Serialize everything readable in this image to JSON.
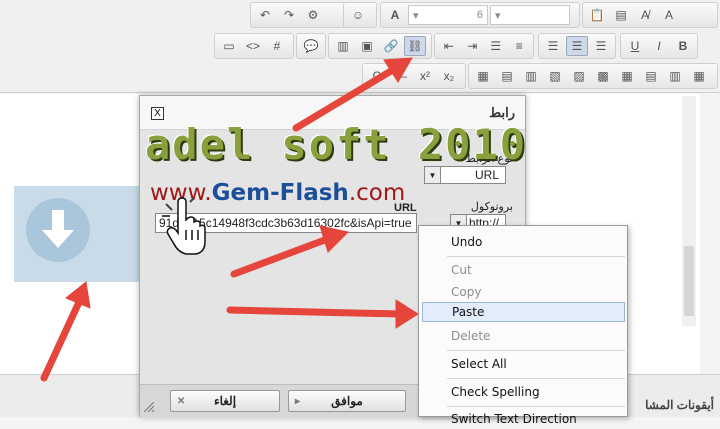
{
  "toolbar": {
    "font_size_value": "6"
  },
  "dialog": {
    "title": "رابط",
    "close_label": "X",
    "link_type_label": "نوع الرابط",
    "link_type_value": "URL",
    "url_label": "URL",
    "protocol_label": "بروتوكول",
    "protocol_value": "http://",
    "url_value": "91d6615c14948f3cdc3b63d16302fc&isApi=true",
    "ok_label": "موافق",
    "cancel_label": "إلغاء"
  },
  "context_menu": {
    "items": [
      {
        "label": "Undo",
        "enabled": true
      },
      {
        "label": "Cut",
        "enabled": false
      },
      {
        "label": "Copy",
        "enabled": false
      },
      {
        "label": "Paste",
        "enabled": true,
        "highlighted": true
      },
      {
        "label": "Delete",
        "enabled": false
      },
      {
        "label": "Select All",
        "enabled": true
      },
      {
        "label": "Check Spelling",
        "enabled": true
      },
      {
        "label": "Switch Text Direction",
        "enabled": true
      }
    ]
  },
  "watermark": {
    "title": "adel soft 2010",
    "site_prefix": "www.",
    "site_name": "Gem-Flash",
    "site_suffix": ".com"
  },
  "footer": {
    "label": "أيقونات المشا"
  },
  "colors": {
    "arrow": "#e5453a",
    "menu_highlight": "#e3ecfa"
  }
}
